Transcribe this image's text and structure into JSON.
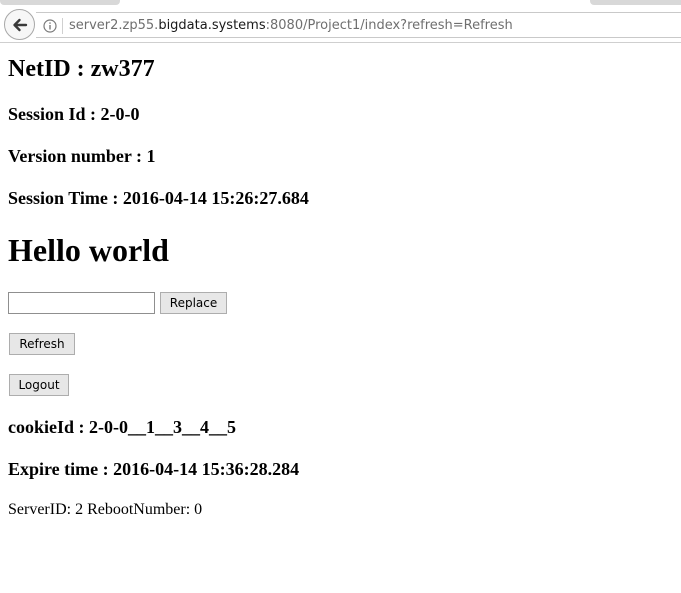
{
  "browser": {
    "url_prefix": "server2.zp55.",
    "url_domain": "bigdata.systems",
    "url_suffix": ":8080/Project1/index?refresh=Refresh"
  },
  "page": {
    "netid": "NetID : zw377",
    "session_id": "Session Id : 2-0-0",
    "version_number": "Version number : 1",
    "session_time": "Session Time : 2016-04-14 15:26:27.684",
    "greeting": "Hello world",
    "replace_input_value": "",
    "replace_button": "Replace",
    "refresh_button": "Refresh",
    "logout_button": "Logout",
    "cookie_id": "cookieId : 2-0-0__1__3__4__5",
    "expire_time": "Expire time : 2016-04-14 15:36:28.284",
    "server_info": "ServerID: 2 RebootNumber: 0"
  },
  "icons": {
    "back": "back-arrow-icon",
    "info": "info-icon"
  }
}
